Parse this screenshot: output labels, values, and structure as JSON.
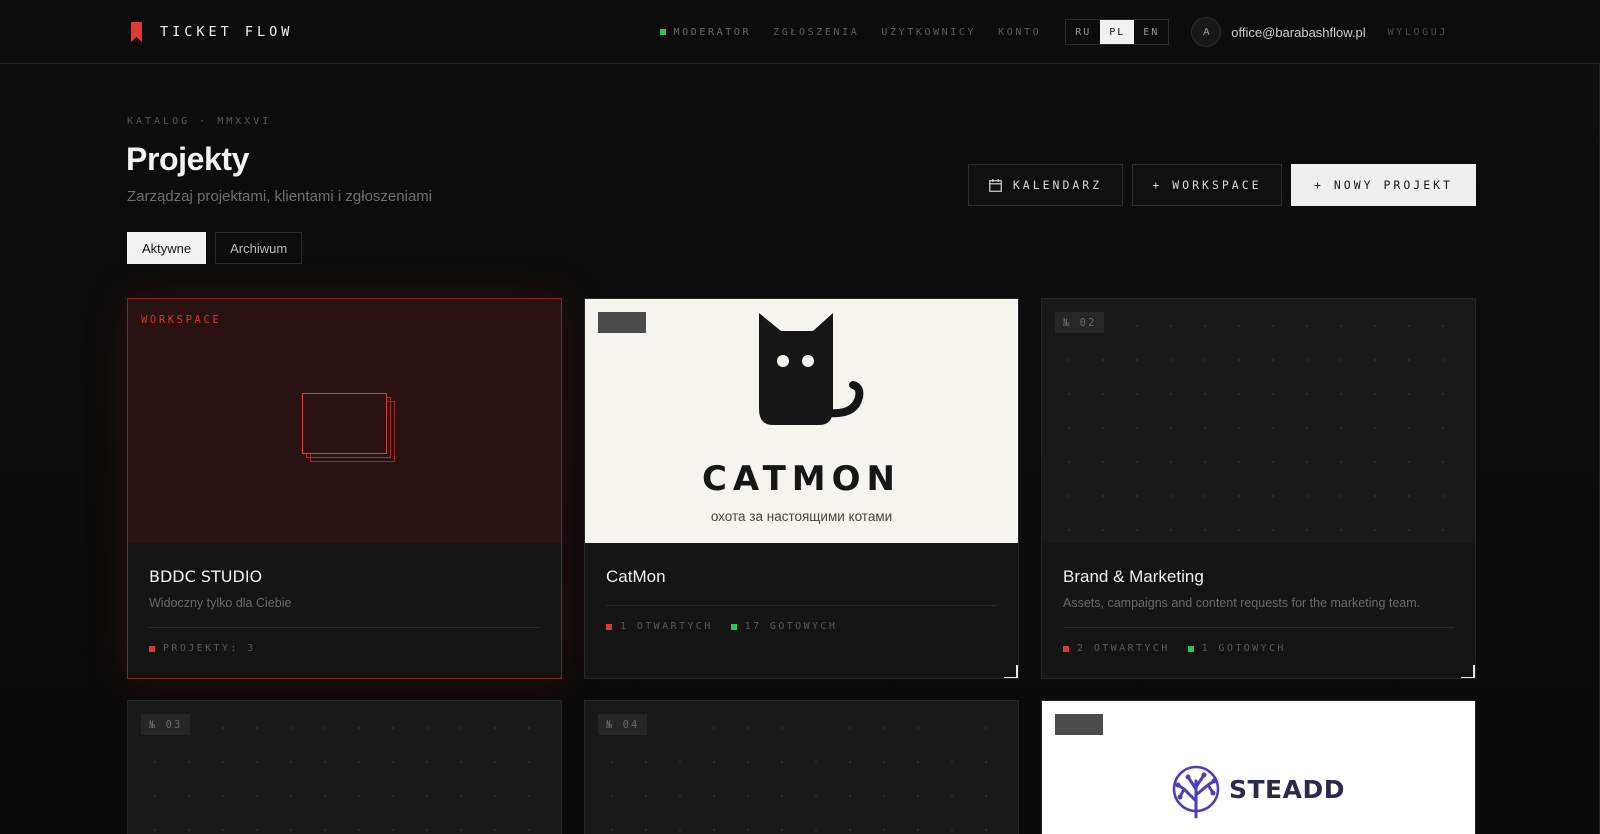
{
  "header": {
    "brand": "TICKET FLOW",
    "role": "MODERATOR",
    "nav": [
      "ZGŁOSZENIA",
      "UŻYTKOWNICY",
      "KONTO"
    ],
    "languages": [
      "RU",
      "PL",
      "EN"
    ],
    "active_language": "PL",
    "avatar_initial": "A",
    "email": "office@barabashflow.pl",
    "logout": "WYLOGUJ"
  },
  "page": {
    "eyebrow": "KATALOG · MMXXVI",
    "title": "Projekty",
    "subtitle": "Zarządzaj projektami, klientami i zgłoszeniami"
  },
  "actions": {
    "calendar": "KALENDARZ",
    "workspace": "+ WORKSPACE",
    "new_project": "+ NOWY PROJEKT"
  },
  "tabs": [
    "Aktywne",
    "Archiwum"
  ],
  "active_tab": "Aktywne",
  "cards": [
    {
      "label": "WORKSPACE",
      "title": "BDDC STUDIO",
      "description": "Widoczny tylko dla Ciebie",
      "projects": "PROJEKTY: 3"
    },
    {
      "title": "CatMon",
      "logo_text": "CATMON",
      "logo_tagline": "охота за настоящими котами",
      "open": "1 OTWARTYCH",
      "done": "17 GOTOWYCH"
    },
    {
      "badge": "№ 02",
      "title": "Brand & Marketing",
      "description": "Assets, campaigns and content requests for the marketing team.",
      "open": "2 OTWARTYCH",
      "done": "1 GOTOWYCH"
    },
    {
      "badge": "№ 03"
    },
    {
      "badge": "№ 04"
    },
    {
      "logo_text": "STEADD"
    }
  ],
  "colors": {
    "accent_red": "#d83a34",
    "status_green": "#33c15b",
    "background": "#0a0a0a",
    "steadd_purple": "#4a3fb5",
    "steadd_dark": "#2a2a4a"
  }
}
